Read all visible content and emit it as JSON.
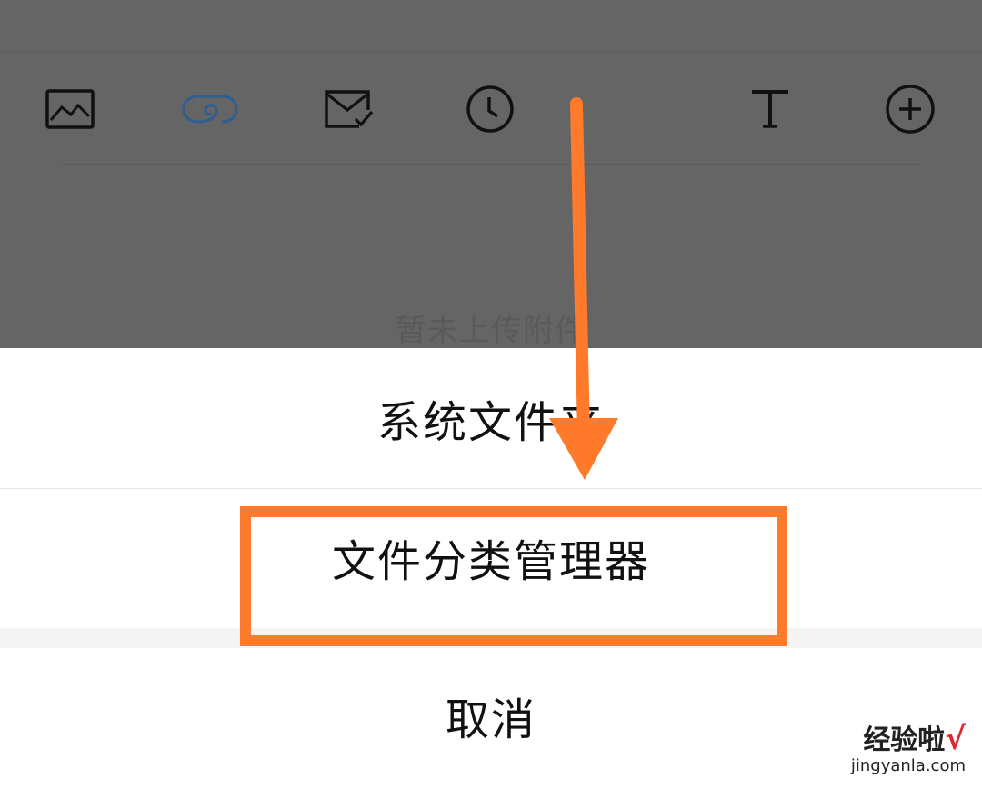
{
  "toolbar": {
    "icons": [
      "image-icon",
      "attachment-icon",
      "mail-check-icon",
      "clock-icon",
      "text-format-icon",
      "add-circle-icon"
    ],
    "active_icon_color": "#2f5f8f",
    "icon_color": "#111111"
  },
  "attachments": {
    "empty_text": "暂未上传附件"
  },
  "action_sheet": {
    "system_folder": "系统文件夹",
    "file_manager": "文件分类管理器",
    "cancel": "取消"
  },
  "annotation": {
    "highlight_color": "#ff7a2b"
  },
  "watermark": {
    "title": "经验啦",
    "check": "√",
    "url": "jingyanla.com"
  }
}
